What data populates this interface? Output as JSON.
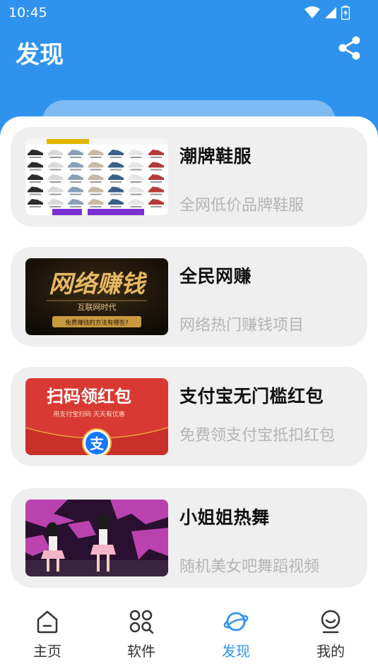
{
  "status": {
    "time": "10:45"
  },
  "header": {
    "title": "发现"
  },
  "icons": {
    "wifi": "wifi-icon",
    "signal": "signal-icon",
    "battery": "battery-icon",
    "share": "share-icon",
    "home": "home-icon",
    "apps": "apps-icon",
    "discover": "planet-icon",
    "profile": "smile-icon"
  },
  "colors": {
    "primary": "#2f93ee",
    "card_bg": "#efefef",
    "muted_text": "#b4b4b4"
  },
  "cards": [
    {
      "title": "潮牌鞋服",
      "desc": "全网低价品牌鞋服"
    },
    {
      "title": "全民网赚",
      "desc": "网络热门赚钱项目"
    },
    {
      "title": "支付宝无门槛红包",
      "desc": "免费领支付宝抵扣红包"
    },
    {
      "title": "小姐姐热舞",
      "desc": "随机美女吧舞蹈视频"
    }
  ],
  "thumbs": {
    "money": {
      "headline": "网络赚钱",
      "sub": "互联网时代",
      "tag": "免费赚钱的方法有哪些?"
    },
    "alipay": {
      "headline": "扫码领红包",
      "sub": "用支付宝扫码 天天有优惠",
      "logo": "支"
    }
  },
  "nav": [
    {
      "label": "主页"
    },
    {
      "label": "软件"
    },
    {
      "label": "发现",
      "active": true
    },
    {
      "label": "我的"
    }
  ]
}
